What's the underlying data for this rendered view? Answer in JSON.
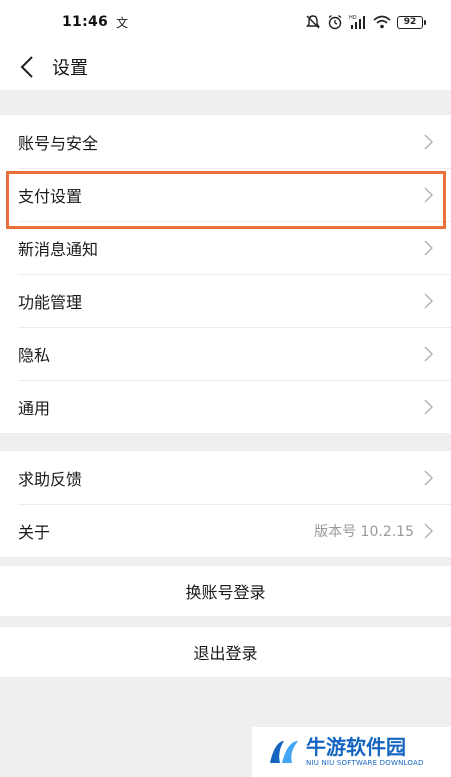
{
  "status_bar": {
    "time": "11:46",
    "notification_glyph": "文",
    "battery": "92",
    "icons": [
      "mute-icon",
      "alarm-icon",
      "hd-signal-icon",
      "wifi-icon",
      "battery-icon"
    ]
  },
  "nav": {
    "title": "设置"
  },
  "settings_group_1": [
    {
      "label": "账号与安全"
    },
    {
      "label": "支付设置"
    },
    {
      "label": "新消息通知"
    },
    {
      "label": "功能管理"
    },
    {
      "label": "隐私"
    },
    {
      "label": "通用"
    }
  ],
  "settings_group_2": [
    {
      "label": "求助反馈",
      "value": ""
    },
    {
      "label": "关于",
      "value": "版本号 10.2.15"
    }
  ],
  "actions": {
    "switch_account": "换账号登录",
    "logout": "退出登录"
  },
  "highlight_color": "#e8703a",
  "watermark": {
    "main": "牛游软件园",
    "sub": "NIU NIU SOFTWARE DOWNLOAD",
    "color": "#1565c0"
  }
}
